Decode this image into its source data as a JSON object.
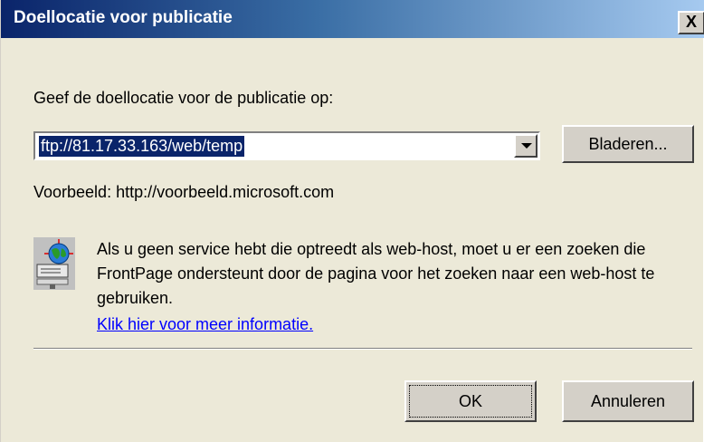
{
  "window": {
    "title": "Doellocatie voor publicatie",
    "close_label": "X"
  },
  "form": {
    "prompt_label": "Geef de doellocatie voor de publicatie op:",
    "location_value": "ftp://81.17.33.163/web/temp",
    "browse_label": "Bladeren...",
    "example_text": "Voorbeeld: http://voorbeeld.microsoft.com"
  },
  "info": {
    "icon": "globe-web-server-icon",
    "message": "Als u geen service hebt die optreedt als web-host, moet u er een zoeken die FrontPage ondersteunt door de pagina voor het zoeken naar een web-host te gebruiken.",
    "link_text": "Klik hier voor meer informatie."
  },
  "buttons": {
    "ok_label": "OK",
    "cancel_label": "Annuleren"
  },
  "colors": {
    "titlebar_start": "#0a246a",
    "titlebar_end": "#a6caf0",
    "dialog_bg": "#ece9d8",
    "selection_bg": "#0a246a",
    "link": "#0000ff"
  }
}
